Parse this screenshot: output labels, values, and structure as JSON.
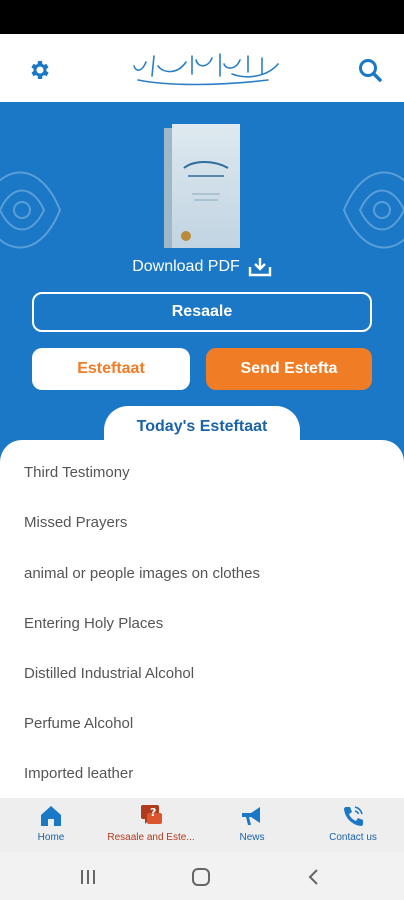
{
  "app": {
    "bismillah_alt": "Bismillah calligraphy"
  },
  "hero": {
    "download_label": "Download PDF",
    "resaale_label": "Resaale",
    "esteftaat_label": "Esteftaat",
    "send_estefta_label": "Send Estefta",
    "today_tab_label": "Today's Esteftaat"
  },
  "list": {
    "items": [
      "Third Testimony",
      "Missed Prayers",
      "animal or people images on clothes",
      "Entering Holy Places",
      "Distilled Industrial Alcohol",
      "Perfume Alcohol",
      "Imported leather"
    ]
  },
  "bottom_nav": {
    "items": [
      {
        "label": "Home",
        "icon": "home-icon",
        "active": false
      },
      {
        "label": "Resaale and Este...",
        "icon": "chat-question-icon",
        "active": true
      },
      {
        "label": "News",
        "icon": "megaphone-icon",
        "active": false
      },
      {
        "label": "Contact us",
        "icon": "phone-icon",
        "active": false
      }
    ]
  },
  "colors": {
    "primary_blue": "#1a78c6",
    "accent_orange": "#f07c26",
    "active_red": "#b03a1c"
  }
}
